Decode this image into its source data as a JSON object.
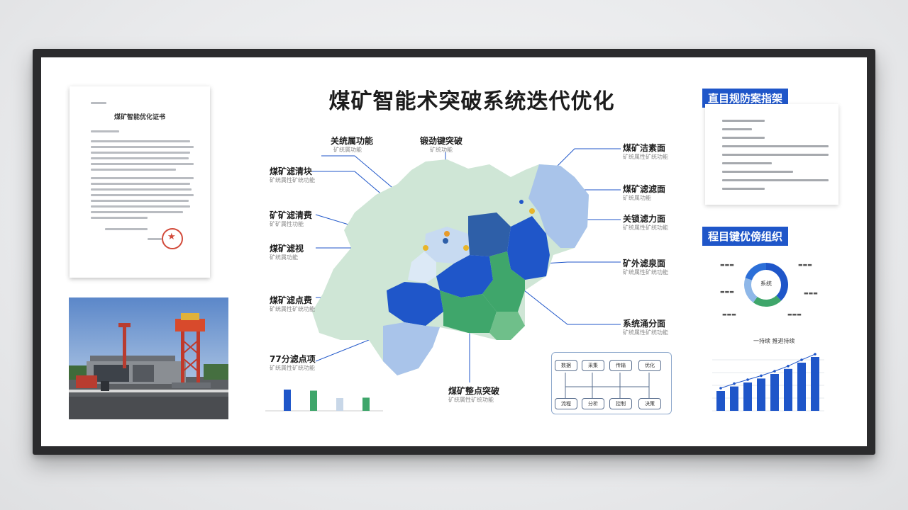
{
  "title": "煤矿智能术突破系统迭代优化",
  "certificate": {
    "title": "煤矿智能优化证书"
  },
  "top_right_box": {
    "header": "直目规防案指架"
  },
  "mid_right": {
    "header": "程目键优傍组织"
  },
  "map_labels": [
    {
      "main": "关统属功能",
      "sub": "矿统属功能"
    },
    {
      "main": "锻劲键突破",
      "sub": "矿统功能"
    },
    {
      "main": "煤矿滤清块",
      "sub": "矿统属性矿统功能"
    },
    {
      "main": "煤矿洁素面",
      "sub": "矿统属性矿统功能"
    },
    {
      "main": "矿矿滤清费",
      "sub": "矿矿属性功能"
    },
    {
      "main": "煤矿滤滤面",
      "sub": "矿统属功能"
    },
    {
      "main": "煤矿滤视",
      "sub": "矿统属功能"
    },
    {
      "main": "关锁滤力面",
      "sub": "矿统属性矿统功能"
    },
    {
      "main": "煤矿滤点费",
      "sub": "矿统属性矿统功能"
    },
    {
      "main": "矿外滤泉面",
      "sub": "矿统属性矿统功能"
    },
    {
      "main": "77分滤点项",
      "sub": "矿统属性矿统功能"
    },
    {
      "main": "系统涌分面",
      "sub": "矿统属性矿统功能"
    },
    {
      "main": "煤矿整点突破",
      "sub": "矿统属性矿统功能"
    }
  ],
  "flow_nodes": [
    "数据",
    "采集",
    "传输",
    "优化",
    "流程",
    "分析",
    "控制",
    "决策"
  ],
  "donut": {
    "center": "系统",
    "segments": [
      {
        "value": 0.38,
        "color": "#1f56c9"
      },
      {
        "value": 0.22,
        "color": "#3fa66b"
      },
      {
        "value": 0.2,
        "color": "#8eb7e8"
      },
      {
        "value": 0.2,
        "color": "#2c6fd8"
      }
    ]
  },
  "small_bars": [
    {
      "value": 1.0,
      "color": "#1f56c9"
    },
    {
      "value": 0.95,
      "color": "#3fa66b"
    },
    {
      "value": 0.6,
      "color": "#c8d7e8"
    },
    {
      "value": 0.62,
      "color": "#3fa66b"
    }
  ],
  "right_bars": {
    "legend": "一持续  推进持续",
    "values": [
      0.35,
      0.43,
      0.5,
      0.57,
      0.65,
      0.74,
      0.85,
      0.95
    ],
    "color": "#1f56c9"
  },
  "colors": {
    "accent_blue": "#1f56c9",
    "green": "#3fa66b",
    "light_blue": "#a9c4ea",
    "light_green": "#cfe6d6"
  }
}
